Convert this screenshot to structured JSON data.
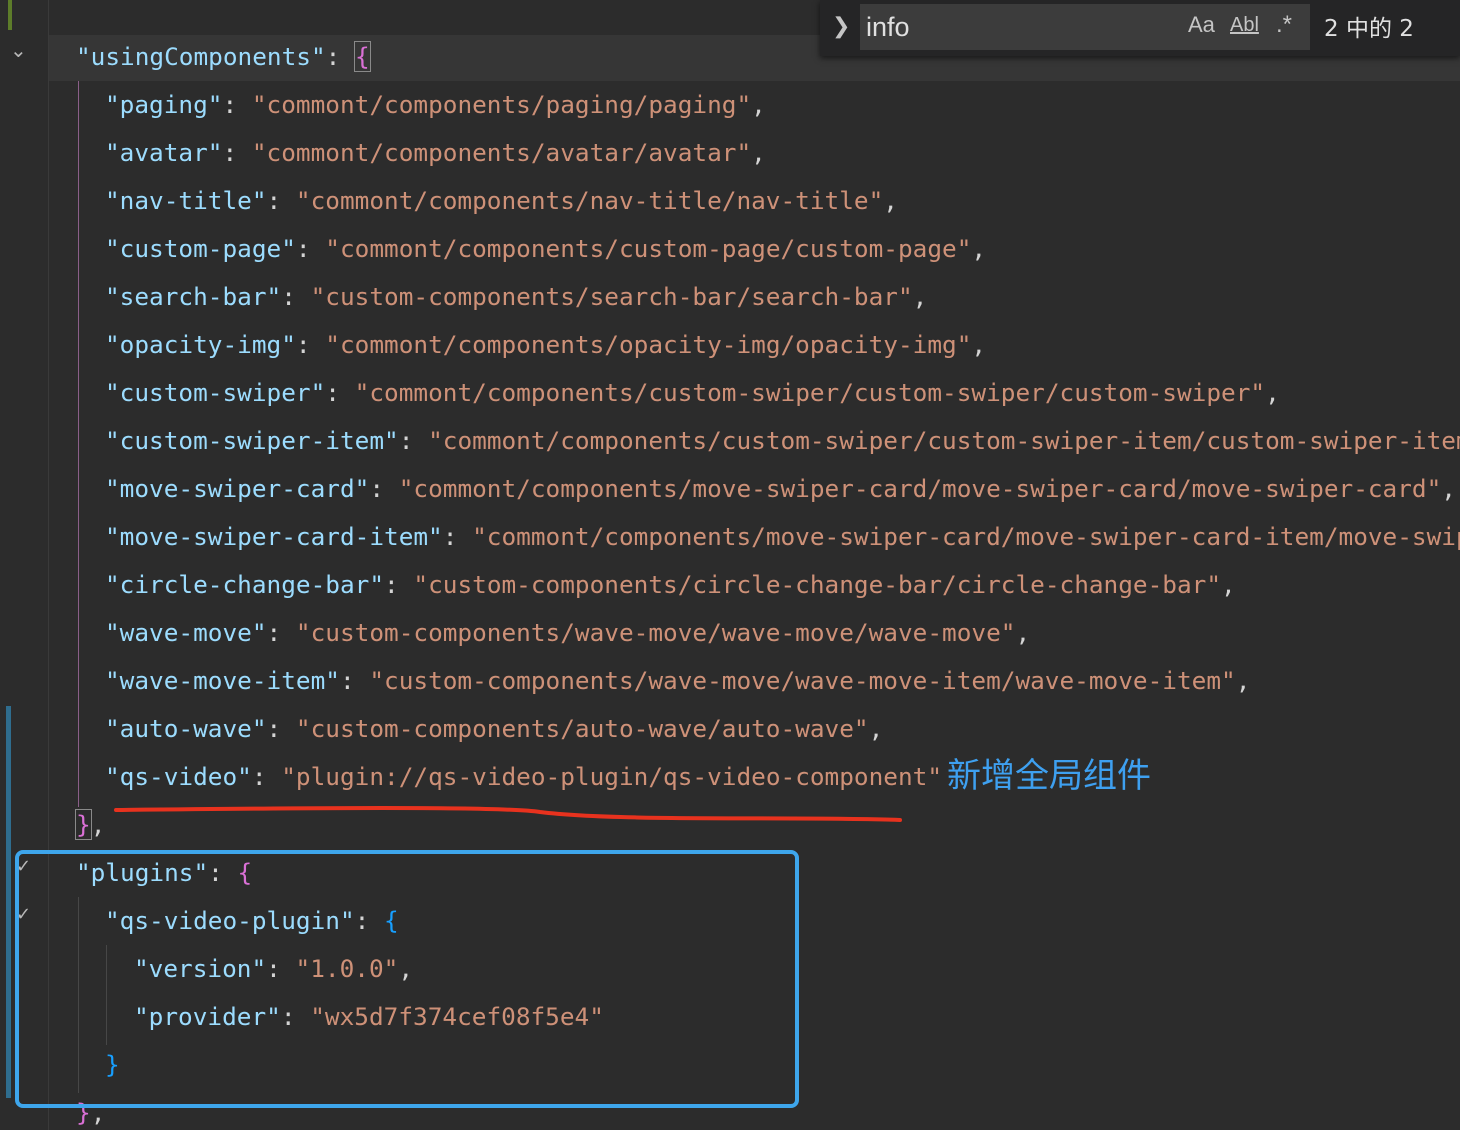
{
  "find_widget": {
    "query": "info",
    "match_case_label": "Aa",
    "whole_word_label": "Abl",
    "regex_label": ".*",
    "result_count": "2 中的 2"
  },
  "annotation": {
    "note": "新增全局组件",
    "underline_color": "#e8321e",
    "box_color": "#3ea6ec"
  },
  "code": {
    "line1": {
      "key": "\"usingComponents\"",
      "sep": ": ",
      "brace": "{"
    },
    "entries": [
      {
        "key": "\"paging\"",
        "sep": ": ",
        "value": "\"commont/components/paging/paging\"",
        "tail": ","
      },
      {
        "key": "\"avatar\"",
        "sep": ": ",
        "value": "\"commont/components/avatar/avatar\"",
        "tail": ","
      },
      {
        "key": "\"nav-title\"",
        "sep": ": ",
        "value": "\"commont/components/nav-title/nav-title\"",
        "tail": ","
      },
      {
        "key": "\"custom-page\"",
        "sep": ": ",
        "value": "\"commont/components/custom-page/custom-page\"",
        "tail": ","
      },
      {
        "key": "\"search-bar\"",
        "sep": ": ",
        "value": "\"custom-components/search-bar/search-bar\"",
        "tail": ","
      },
      {
        "key": "\"opacity-img\"",
        "sep": ": ",
        "value": "\"commont/components/opacity-img/opacity-img\"",
        "tail": ","
      },
      {
        "key": "\"custom-swiper\"",
        "sep": ": ",
        "value": "\"commont/components/custom-swiper/custom-swiper/custom-swiper\"",
        "tail": ","
      },
      {
        "key": "\"custom-swiper-item\"",
        "sep": ": ",
        "value": "\"commont/components/custom-swiper/custom-swiper-item/custom-swiper-item\"",
        "tail": ""
      },
      {
        "key": "\"move-swiper-card\"",
        "sep": ": ",
        "value": "\"commont/components/move-swiper-card/move-swiper-card/move-swiper-card\"",
        "tail": ","
      },
      {
        "key": "\"move-swiper-card-item\"",
        "sep": ": ",
        "value": "\"commont/components/move-swiper-card/move-swiper-card-item/move-swipe",
        "tail": ""
      },
      {
        "key": "\"circle-change-bar\"",
        "sep": ": ",
        "value": "\"custom-components/circle-change-bar/circle-change-bar\"",
        "tail": ","
      },
      {
        "key": "\"wave-move\"",
        "sep": ": ",
        "value": "\"custom-components/wave-move/wave-move/wave-move\"",
        "tail": ","
      },
      {
        "key": "\"wave-move-item\"",
        "sep": ": ",
        "value": "\"custom-components/wave-move/wave-move-item/wave-move-item\"",
        "tail": ","
      },
      {
        "key": "\"auto-wave\"",
        "sep": ": ",
        "value": "\"custom-components/auto-wave/auto-wave\"",
        "tail": ","
      },
      {
        "key": "\"qs-video\"",
        "sep": ": ",
        "value": "\"plugin://qs-video-plugin/qs-video-component\"",
        "tail": ""
      }
    ],
    "close1": {
      "brace": "}",
      "tail": ","
    },
    "plugins": {
      "key": "\"plugins\"",
      "sep": ": ",
      "brace": "{"
    },
    "plugin": {
      "key": "\"qs-video-plugin\"",
      "sep": ": ",
      "brace": "{"
    },
    "version": {
      "key": "\"version\"",
      "sep": ": ",
      "value": "\"1.0.0\"",
      "tail": ","
    },
    "provider": {
      "key": "\"provider\"",
      "sep": ": ",
      "value": "\"wx5d7f374cef08f5e4\""
    },
    "close_plugin": {
      "brace": "}"
    },
    "close_plugins": {
      "brace": "}",
      "tail": ","
    }
  }
}
